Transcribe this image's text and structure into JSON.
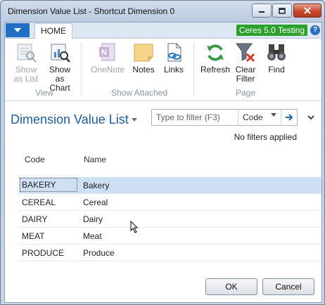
{
  "window": {
    "title": "Dimension Value List - Shortcut Dimension 0"
  },
  "ribbon": {
    "tab": "HOME",
    "company_badge": "Ceres 5.0 Testing",
    "groups": [
      {
        "label": "View",
        "buttons": [
          {
            "label": "Show as List",
            "lines": [
              "Show",
              "as List"
            ],
            "icon": "list-view-icon",
            "enabled": false
          },
          {
            "label": "Show as Chart",
            "lines": [
              "Show as",
              "Chart"
            ],
            "icon": "chart-view-icon",
            "enabled": true
          }
        ]
      },
      {
        "label": "Show Attached",
        "buttons": [
          {
            "label": "OneNote",
            "icon": "onenote-icon",
            "enabled": false
          },
          {
            "label": "Notes",
            "icon": "notes-icon",
            "enabled": true
          },
          {
            "label": "Links",
            "icon": "links-icon",
            "enabled": true
          }
        ]
      },
      {
        "label": "Page",
        "buttons": [
          {
            "label": "Refresh",
            "icon": "refresh-icon",
            "enabled": true
          },
          {
            "label": "Clear Filter",
            "lines": [
              "Clear",
              "Filter"
            ],
            "icon": "clear-filter-icon",
            "enabled": true
          },
          {
            "label": "Find",
            "icon": "binoculars-icon",
            "enabled": true
          }
        ]
      }
    ]
  },
  "page": {
    "title": "Dimension Value List",
    "filter_placeholder": "Type to filter (F3)",
    "filter_field": "Code",
    "filter_status": "No filters applied"
  },
  "table": {
    "columns": [
      "Code",
      "Name"
    ],
    "rows": [
      {
        "code": "BAKERY",
        "name": "Bakery",
        "selected": true
      },
      {
        "code": "CEREAL",
        "name": "Cereal",
        "selected": false
      },
      {
        "code": "DAIRY",
        "name": "Dairy",
        "selected": false
      },
      {
        "code": "MEAT",
        "name": "Meat",
        "selected": false
      },
      {
        "code": "PRODUCE",
        "name": "Produce",
        "selected": false
      }
    ]
  },
  "buttons": {
    "ok": "OK",
    "cancel": "Cancel"
  },
  "colors": {
    "accent": "#1f6fc5",
    "badge": "#2aa12a",
    "selected_row": "#cfe0f5",
    "title": "#1d5d9c"
  }
}
